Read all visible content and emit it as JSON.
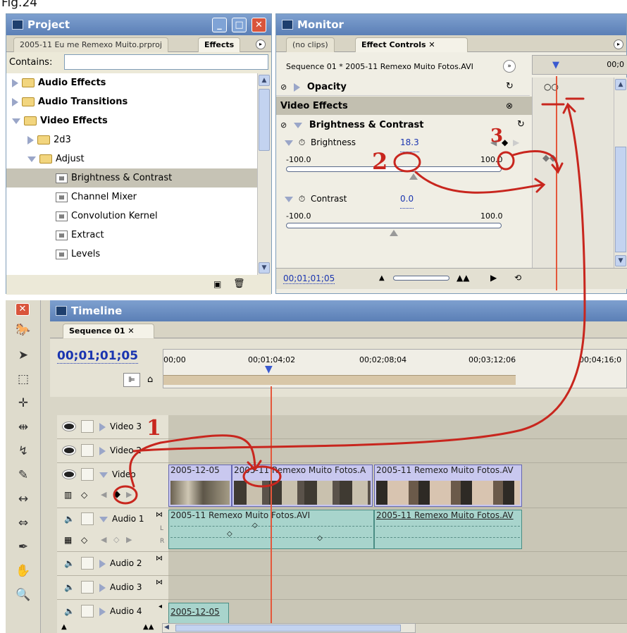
{
  "figure_label": "Fig.24",
  "project": {
    "title": "Project",
    "tabs": [
      "2005-11 Eu me Remexo Muito.prproj",
      "Effects"
    ],
    "contains_label": "Contains:",
    "contains_value": "",
    "tree": [
      {
        "label": "Audio Effects",
        "bold": true
      },
      {
        "label": "Audio Transitions",
        "bold": true
      },
      {
        "label": "Video Effects",
        "bold": true
      },
      {
        "label": "2d3"
      },
      {
        "label": "Adjust"
      },
      {
        "label": "Brightness & Contrast"
      },
      {
        "label": "Channel Mixer"
      },
      {
        "label": "Convolution Kernel"
      },
      {
        "label": "Extract"
      },
      {
        "label": "Levels"
      }
    ]
  },
  "monitor": {
    "title": "Monitor",
    "tabs": [
      "(no clips)",
      "Effect Controls"
    ],
    "sequence_label": "Sequence 01 * 2005-11 Remexo Muito Fotos.AVI",
    "ruler_time": "00;0",
    "opacity_label": "Opacity",
    "video_effects_label": "Video Effects",
    "bc_label": "Brightness & Contrast",
    "brightness_label": "Brightness",
    "brightness_value": "18.3",
    "brightness_min": "-100.0",
    "brightness_max": "100.0",
    "brightness_level": 0.59,
    "contrast_label": "Contrast",
    "contrast_value": "0.0",
    "contrast_min": "-100.0",
    "contrast_max": "100.0",
    "contrast_level": 0.5,
    "timecode": "00;01;01;05"
  },
  "timeline": {
    "title": "Timeline",
    "tab": "Sequence 01",
    "timecode": "00;01;01;05",
    "ruler_ticks": [
      "00;00",
      "00;01;04;02",
      "00;02;08;04",
      "00;03;12;06",
      "00;04;16;0"
    ],
    "tracks": {
      "video3": "Video 3",
      "video2": "Video 2",
      "video1": "Video",
      "audio1": "Audio 1",
      "audio2": "Audio 2",
      "audio3": "Audio 3",
      "audio4": "Audio 4"
    },
    "clips": {
      "v1a": "2005-12-05",
      "v1b": "2005-11 Remexo Muito Fotos.A",
      "v1c": "2005-11 Remexo Muito Fotos.AV",
      "a1a": "2005-11 Remexo Muito Fotos.AVI",
      "a1b": "2005-11 Remexo Muito Fotos.AV",
      "a4a": "2005-12-05"
    },
    "audio_letters": [
      "L",
      "R"
    ]
  },
  "annotations": [
    "1",
    "2",
    "3"
  ],
  "colors": {
    "accent_red": "#c8261e",
    "playhead": "#e4573b",
    "titlebar": "#6687bd"
  }
}
